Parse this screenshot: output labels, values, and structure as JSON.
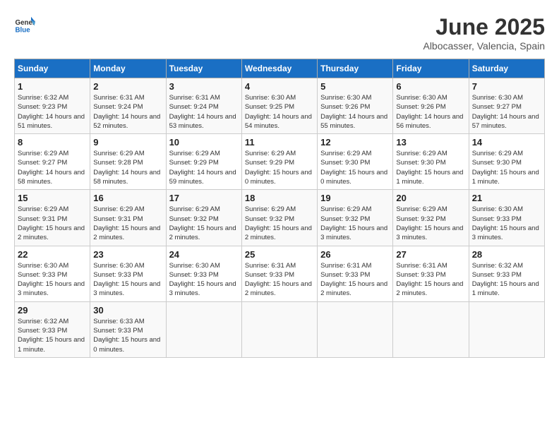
{
  "header": {
    "logo_line1": "General",
    "logo_line2": "Blue",
    "month_title": "June 2025",
    "location": "Albocasser, Valencia, Spain"
  },
  "weekdays": [
    "Sunday",
    "Monday",
    "Tuesday",
    "Wednesday",
    "Thursday",
    "Friday",
    "Saturday"
  ],
  "weeks": [
    [
      {
        "day": "1",
        "sunrise": "6:32 AM",
        "sunset": "9:23 PM",
        "daylight": "14 hours and 51 minutes."
      },
      {
        "day": "2",
        "sunrise": "6:31 AM",
        "sunset": "9:24 PM",
        "daylight": "14 hours and 52 minutes."
      },
      {
        "day": "3",
        "sunrise": "6:31 AM",
        "sunset": "9:24 PM",
        "daylight": "14 hours and 53 minutes."
      },
      {
        "day": "4",
        "sunrise": "6:30 AM",
        "sunset": "9:25 PM",
        "daylight": "14 hours and 54 minutes."
      },
      {
        "day": "5",
        "sunrise": "6:30 AM",
        "sunset": "9:26 PM",
        "daylight": "14 hours and 55 minutes."
      },
      {
        "day": "6",
        "sunrise": "6:30 AM",
        "sunset": "9:26 PM",
        "daylight": "14 hours and 56 minutes."
      },
      {
        "day": "7",
        "sunrise": "6:30 AM",
        "sunset": "9:27 PM",
        "daylight": "14 hours and 57 minutes."
      }
    ],
    [
      {
        "day": "8",
        "sunrise": "6:29 AM",
        "sunset": "9:27 PM",
        "daylight": "14 hours and 58 minutes."
      },
      {
        "day": "9",
        "sunrise": "6:29 AM",
        "sunset": "9:28 PM",
        "daylight": "14 hours and 58 minutes."
      },
      {
        "day": "10",
        "sunrise": "6:29 AM",
        "sunset": "9:29 PM",
        "daylight": "14 hours and 59 minutes."
      },
      {
        "day": "11",
        "sunrise": "6:29 AM",
        "sunset": "9:29 PM",
        "daylight": "15 hours and 0 minutes."
      },
      {
        "day": "12",
        "sunrise": "6:29 AM",
        "sunset": "9:30 PM",
        "daylight": "15 hours and 0 minutes."
      },
      {
        "day": "13",
        "sunrise": "6:29 AM",
        "sunset": "9:30 PM",
        "daylight": "15 hours and 1 minute."
      },
      {
        "day": "14",
        "sunrise": "6:29 AM",
        "sunset": "9:30 PM",
        "daylight": "15 hours and 1 minute."
      }
    ],
    [
      {
        "day": "15",
        "sunrise": "6:29 AM",
        "sunset": "9:31 PM",
        "daylight": "15 hours and 2 minutes."
      },
      {
        "day": "16",
        "sunrise": "6:29 AM",
        "sunset": "9:31 PM",
        "daylight": "15 hours and 2 minutes."
      },
      {
        "day": "17",
        "sunrise": "6:29 AM",
        "sunset": "9:32 PM",
        "daylight": "15 hours and 2 minutes."
      },
      {
        "day": "18",
        "sunrise": "6:29 AM",
        "sunset": "9:32 PM",
        "daylight": "15 hours and 2 minutes."
      },
      {
        "day": "19",
        "sunrise": "6:29 AM",
        "sunset": "9:32 PM",
        "daylight": "15 hours and 3 minutes."
      },
      {
        "day": "20",
        "sunrise": "6:29 AM",
        "sunset": "9:32 PM",
        "daylight": "15 hours and 3 minutes."
      },
      {
        "day": "21",
        "sunrise": "6:30 AM",
        "sunset": "9:33 PM",
        "daylight": "15 hours and 3 minutes."
      }
    ],
    [
      {
        "day": "22",
        "sunrise": "6:30 AM",
        "sunset": "9:33 PM",
        "daylight": "15 hours and 3 minutes."
      },
      {
        "day": "23",
        "sunrise": "6:30 AM",
        "sunset": "9:33 PM",
        "daylight": "15 hours and 3 minutes."
      },
      {
        "day": "24",
        "sunrise": "6:30 AM",
        "sunset": "9:33 PM",
        "daylight": "15 hours and 3 minutes."
      },
      {
        "day": "25",
        "sunrise": "6:31 AM",
        "sunset": "9:33 PM",
        "daylight": "15 hours and 2 minutes."
      },
      {
        "day": "26",
        "sunrise": "6:31 AM",
        "sunset": "9:33 PM",
        "daylight": "15 hours and 2 minutes."
      },
      {
        "day": "27",
        "sunrise": "6:31 AM",
        "sunset": "9:33 PM",
        "daylight": "15 hours and 2 minutes."
      },
      {
        "day": "28",
        "sunrise": "6:32 AM",
        "sunset": "9:33 PM",
        "daylight": "15 hours and 1 minute."
      }
    ],
    [
      {
        "day": "29",
        "sunrise": "6:32 AM",
        "sunset": "9:33 PM",
        "daylight": "15 hours and 1 minute."
      },
      {
        "day": "30",
        "sunrise": "6:33 AM",
        "sunset": "9:33 PM",
        "daylight": "15 hours and 0 minutes."
      },
      null,
      null,
      null,
      null,
      null
    ]
  ],
  "labels": {
    "sunrise": "Sunrise:",
    "sunset": "Sunset:",
    "daylight": "Daylight:"
  }
}
